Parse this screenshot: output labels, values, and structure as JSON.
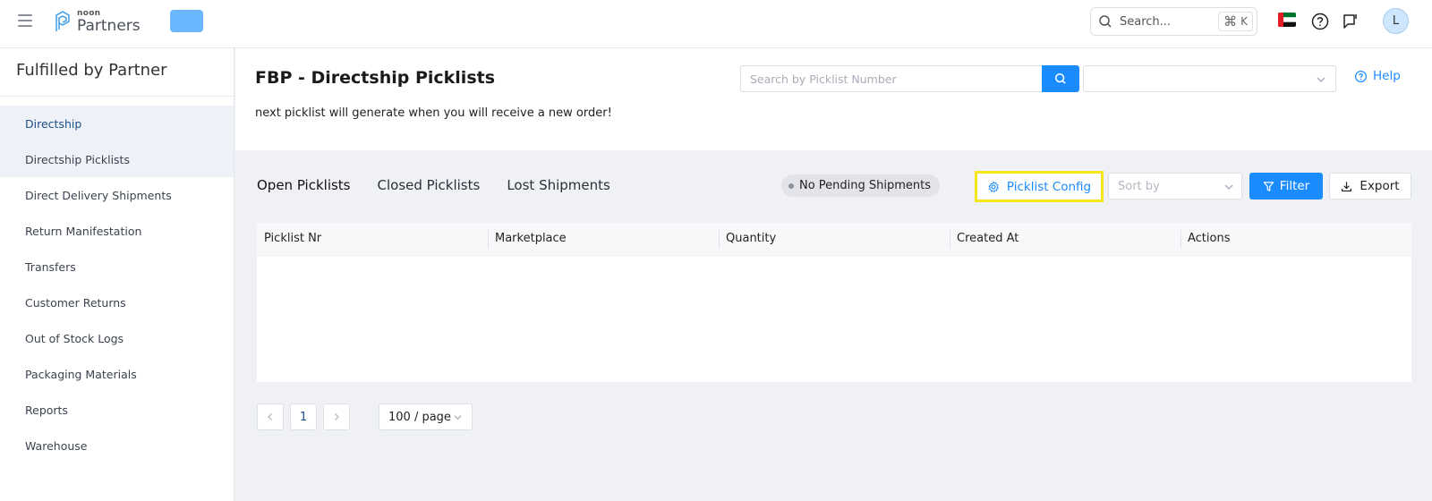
{
  "topbar": {
    "logo_small": "noon",
    "logo_big": "Partners",
    "search_placeholder": "Search...",
    "shortcut_symbol": "⌘",
    "shortcut_key": "K",
    "avatar_initial": "L",
    "icons": [
      "menu-icon",
      "search-icon",
      "flag-icon",
      "help-circle-icon",
      "chat-flag-icon"
    ]
  },
  "sidebar": {
    "title": "Fulfilled by Partner",
    "items": [
      {
        "label": "Directship"
      },
      {
        "label": "Directship Picklists"
      },
      {
        "label": "Direct Delivery Shipments"
      },
      {
        "label": "Return Manifestation"
      },
      {
        "label": "Transfers"
      },
      {
        "label": "Customer Returns"
      },
      {
        "label": "Out of Stock Logs"
      },
      {
        "label": "Packaging Materials"
      },
      {
        "label": "Reports"
      },
      {
        "label": "Warehouse"
      }
    ]
  },
  "header": {
    "title": "FBP - Directship Picklists",
    "note": "next picklist will generate when you will receive a new order!",
    "search_placeholder": "Search by Picklist Number",
    "select_value": "",
    "help_label": "Help"
  },
  "tabs": [
    {
      "label": "Open Picklists"
    },
    {
      "label": "Closed Picklists"
    },
    {
      "label": "Lost Shipments"
    }
  ],
  "toolbar": {
    "status_badge": "No Pending Shipments",
    "config_label": "Picklist Config",
    "sort_placeholder": "Sort by",
    "filter_label": "Filter",
    "export_label": "Export"
  },
  "table": {
    "columns": [
      "Picklist Nr",
      "Marketplace",
      "Quantity",
      "Created At",
      "Actions"
    ],
    "rows": []
  },
  "pagination": {
    "prev": "<",
    "current_page": "1",
    "next": ">",
    "page_size": "100 / page"
  },
  "colors": {
    "accent": "#1a8cff",
    "highlight": "#f5e61b",
    "store_pill": "#6ab7ff"
  }
}
